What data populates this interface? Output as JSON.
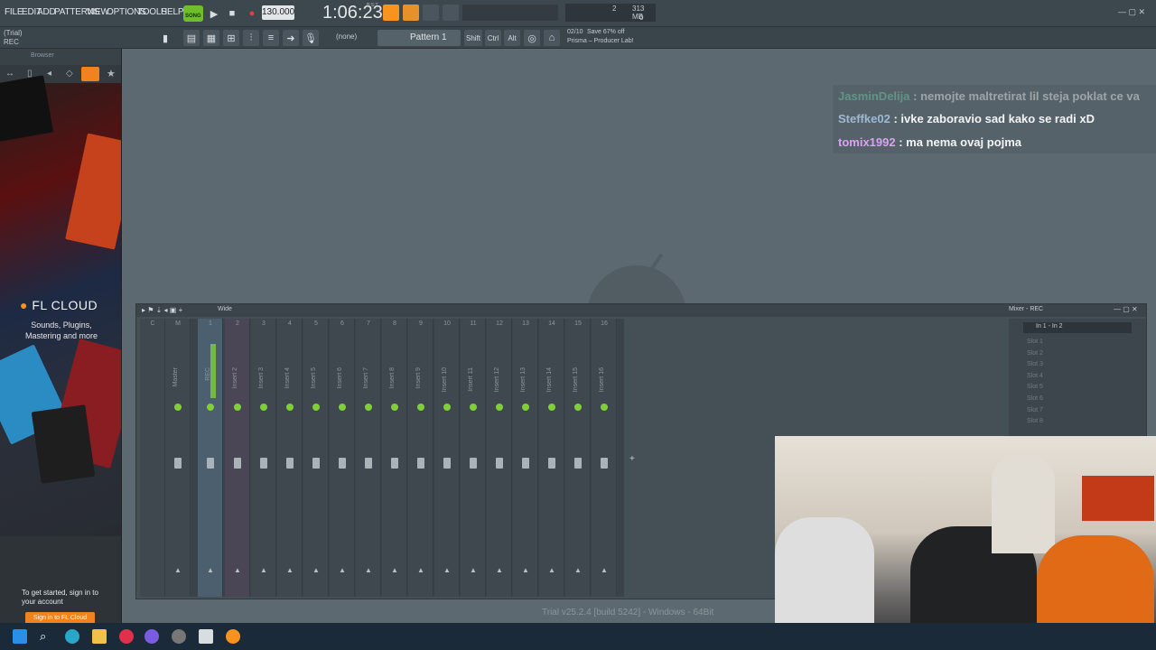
{
  "menubar": {
    "items": [
      "FILE",
      "EDIT",
      "ADD",
      "PATTERNS",
      "VIEW",
      "OPTIONS",
      "TOOLS",
      "HELP"
    ],
    "song_label": "SONG",
    "tempo": "130.000",
    "time": "1:06:23",
    "time_sub": "B:S:T",
    "cpu_top": "2",
    "cpu_mem": "313 MB",
    "cpu_bottom": "0"
  },
  "toolbar2": {
    "trial_label": "(Trial)",
    "rec_label": "REC",
    "snap_value": "(none)",
    "pattern_name": "Pattern 1",
    "key_buttons": [
      "Shift",
      "Ctrl",
      "Alt"
    ],
    "news_counter": "02/10",
    "news_title": "Save 67% off",
    "news_sub": "Prisma – Producer Lab!"
  },
  "browser": {
    "header": "Browser",
    "promo_title": "FL CLOUD",
    "promo_sub": "Sounds, Plugins, Mastering and more",
    "signin_hint": "To get started, sign in to your account",
    "signin_button": "Sign in to FL Cloud"
  },
  "chat": {
    "lines": [
      {
        "user": "JasminDelija",
        "text": ": nemojte maltretirat lil steja poklat ce va"
      },
      {
        "user": "Steffke02",
        "text": ": ivke zaboravio sad kako se radi xD"
      },
      {
        "user": "tomix1992",
        "text": ": ma nema ovaj pojma"
      }
    ]
  },
  "mixer": {
    "header_label": "Wide",
    "window_title": "Mixer - REC",
    "routing": "In 1 - In 2",
    "strip_numbers": [
      "C",
      "M",
      "1",
      "2",
      "3",
      "4",
      "5",
      "6",
      "7",
      "8",
      "9",
      "10",
      "11",
      "12",
      "13",
      "14",
      "15",
      "16"
    ],
    "strip_labels": [
      "",
      "Master",
      "REC",
      "Insert 2",
      "Insert 3",
      "Insert 4",
      "Insert 5",
      "Insert 6",
      "Insert 7",
      "Insert 8",
      "Insert 9",
      "Insert 10",
      "Insert 11",
      "Insert 12",
      "Insert 13",
      "Insert 14",
      "Insert 15",
      "Insert 16"
    ],
    "slots": [
      "Slot 1",
      "Slot 2",
      "Slot 3",
      "Slot 4",
      "Slot 5",
      "Slot 6",
      "Slot 7",
      "Slot 8"
    ],
    "add_label": "+"
  },
  "footer": {
    "version": "Trial v25.2.4 [build 5242] - Windows - 64Bit"
  },
  "colors": {
    "accent_green": "#7fcf3a",
    "fl_orange": "#f7931e",
    "cloud_button": "#f0831e"
  }
}
